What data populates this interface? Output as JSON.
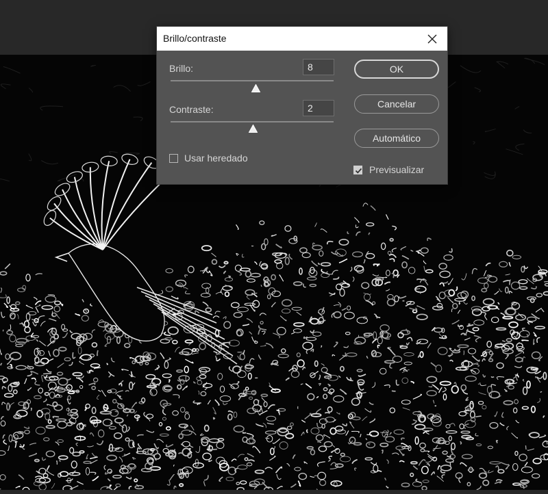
{
  "dialog": {
    "title": "Brillo/contraste",
    "brightness": {
      "label": "Brillo:",
      "value": "8"
    },
    "contrast": {
      "label": "Contraste:",
      "value": "2"
    },
    "legacy": {
      "label": "Usar heredado",
      "checked": false
    },
    "preview": {
      "label": "Previsualizar",
      "checked": true
    },
    "buttons": {
      "ok": "OK",
      "cancel": "Cancelar",
      "auto": "Automático"
    }
  },
  "icons": {
    "close": "close-icon",
    "check": "checkmark-icon"
  },
  "colors": {
    "dialog_bg": "#535353",
    "titlebar_bg": "#ffffff",
    "workspace_bg": "#282828",
    "canvas_bg": "#050505"
  }
}
